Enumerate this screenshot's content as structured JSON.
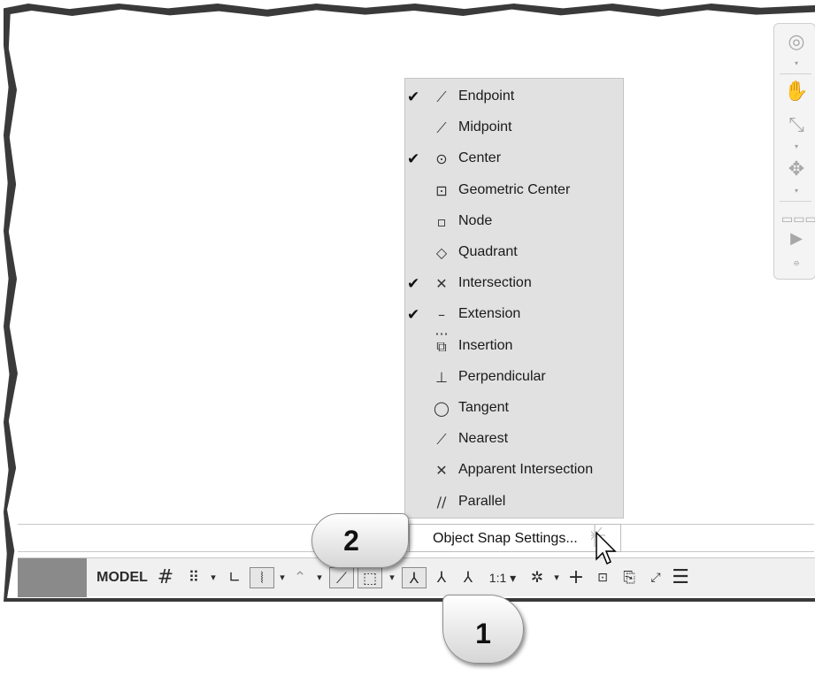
{
  "osnap_menu": {
    "items": [
      {
        "label": "Endpoint",
        "checked": "✔",
        "icon": "endpoint-icon",
        "glyph": "⟋"
      },
      {
        "label": "Midpoint",
        "checked": "",
        "icon": "midpoint-icon",
        "glyph": "⟋"
      },
      {
        "label": "Center",
        "checked": "✔",
        "icon": "center-icon",
        "glyph": "⊙"
      },
      {
        "label": "Geometric Center",
        "checked": "",
        "icon": "geometric-center-icon",
        "glyph": "⊡"
      },
      {
        "label": "Node",
        "checked": "",
        "icon": "node-icon",
        "glyph": "▫"
      },
      {
        "label": "Quadrant",
        "checked": "",
        "icon": "quadrant-icon",
        "glyph": "◇"
      },
      {
        "label": "Intersection",
        "checked": "✔",
        "icon": "intersection-icon",
        "glyph": "✕"
      },
      {
        "label": "Extension",
        "checked": "✔",
        "icon": "extension-icon",
        "glyph": "–···"
      },
      {
        "label": "Insertion",
        "checked": "",
        "icon": "insertion-icon",
        "glyph": "⧉"
      },
      {
        "label": "Perpendicular",
        "checked": "",
        "icon": "perpendicular-icon",
        "glyph": "⊥"
      },
      {
        "label": "Tangent",
        "checked": "",
        "icon": "tangent-icon",
        "glyph": "◯"
      },
      {
        "label": "Nearest",
        "checked": "",
        "icon": "nearest-icon",
        "glyph": "⟋"
      },
      {
        "label": "Apparent Intersection",
        "checked": "",
        "icon": "apparent-intersection-icon",
        "glyph": "✕"
      },
      {
        "label": "Parallel",
        "checked": "",
        "icon": "parallel-icon",
        "glyph": "∕∕"
      }
    ],
    "settings_label": "Object Snap Settings..."
  },
  "statusbar": {
    "model_label": "MODEL",
    "scale_label": "1:1 ▾",
    "grid_glyph": "#",
    "snap_glyph": "⠿",
    "caret": "▾"
  },
  "callouts": {
    "step1": "1",
    "step2": "2"
  }
}
